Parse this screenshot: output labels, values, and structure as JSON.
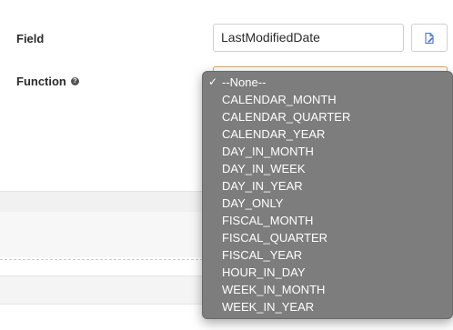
{
  "field": {
    "label": "Field",
    "value": "LastModifiedDate",
    "picker_icon": "insert-field-icon"
  },
  "function": {
    "label": "Function",
    "help_icon": "help-icon",
    "help_glyph": "?"
  },
  "dropdown": {
    "selected_index": 0,
    "check_glyph": "✓",
    "options": [
      "--None--",
      "CALENDAR_MONTH",
      "CALENDAR_QUARTER",
      "CALENDAR_YEAR",
      "DAY_IN_MONTH",
      "DAY_IN_WEEK",
      "DAY_IN_YEAR",
      "DAY_ONLY",
      "FISCAL_MONTH",
      "FISCAL_QUARTER",
      "FISCAL_YEAR",
      "HOUR_IN_DAY",
      "WEEK_IN_MONTH",
      "WEEK_IN_YEAR"
    ]
  },
  "colors": {
    "focus_border": "#e3a64b",
    "dropdown_bg": "#7d7d7d",
    "picker_icon": "#4a74c9"
  }
}
